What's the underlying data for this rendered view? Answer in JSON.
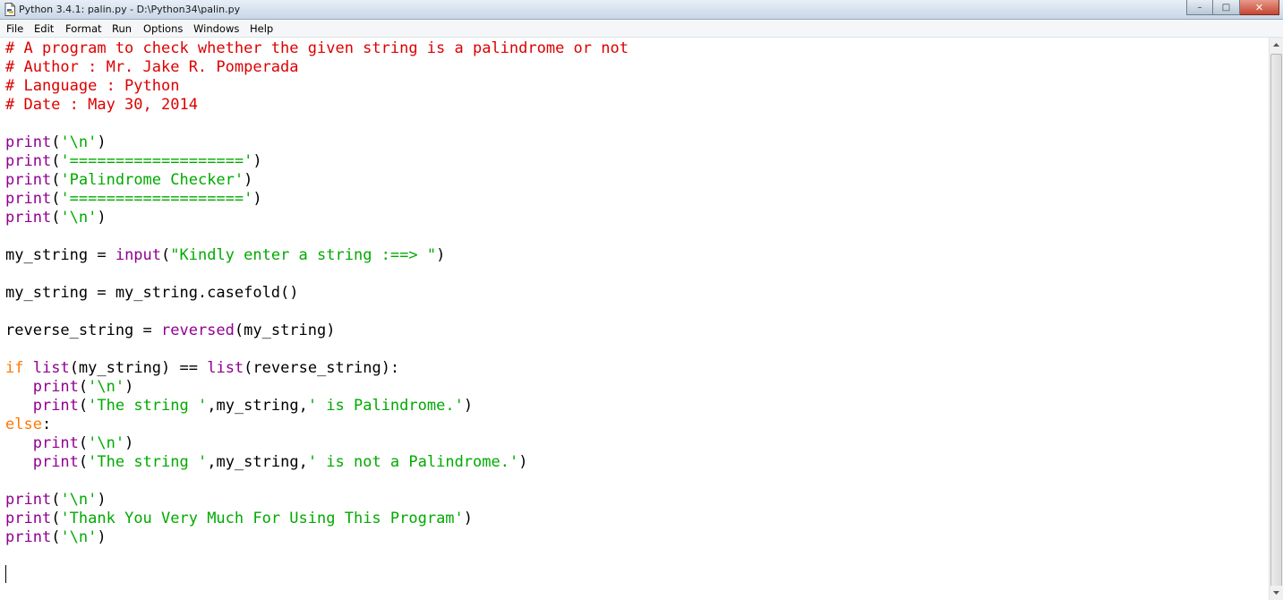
{
  "window": {
    "title": "Python 3.4.1: palin.py - D:\\Python34\\palin.py",
    "minimize_label": "–",
    "maximize_label": "□",
    "close_label": "✕"
  },
  "menu": [
    "File",
    "Edit",
    "Format",
    "Run",
    "Options",
    "Windows",
    "Help"
  ],
  "code": [
    "# A program to check whether the given string is a palindrome or not",
    "# Author : Mr. Jake R. Pomperada",
    "# Language : Python",
    "# Date : May 30, 2014",
    "",
    "print('\\n')",
    "print('===================')",
    "print('Palindrome Checker')",
    "print('===================')",
    "print('\\n')",
    "",
    "my_string = input(\"Kindly enter a string :==> \")",
    "",
    "my_string = my_string.casefold()",
    "",
    "reverse_string = reversed(my_string)",
    "",
    "if list(my_string) == list(reverse_string):",
    "   print('\\n')",
    "   print('The string ',my_string,' is Palindrome.')",
    "else:",
    "   print('\\n')",
    "   print('The string ',my_string,' is not a Palindrome.')",
    "",
    "print('\\n')",
    "print('Thank You Very Much For Using This Program')",
    "print('\\n')"
  ],
  "syntax_colors": {
    "comment": "#dd0000",
    "builtin": "#900090",
    "string": "#00aa00",
    "keyword": "#ff7700",
    "text": "#000000"
  }
}
